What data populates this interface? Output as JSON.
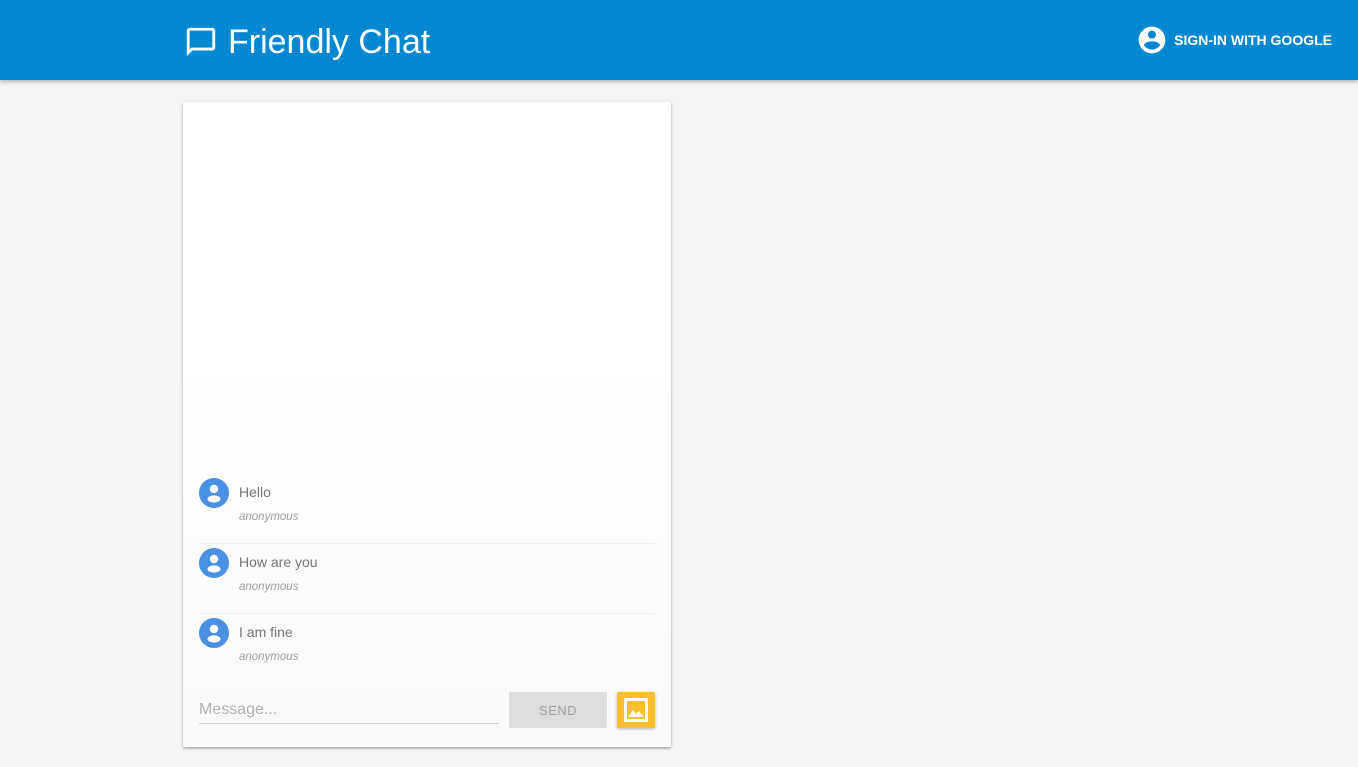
{
  "header": {
    "title": "Friendly Chat",
    "signin_label": "SIGN-IN WITH GOOGLE",
    "brand_icon": "chat-bubble-icon",
    "signin_icon": "account-circle-icon"
  },
  "messages": [
    {
      "text": "Hello",
      "name": "anonymous"
    },
    {
      "text": "How are you",
      "name": "anonymous"
    },
    {
      "text": "I am fine",
      "name": "anonymous"
    }
  ],
  "composer": {
    "placeholder": "Message...",
    "value": "",
    "send_label": "SEND",
    "image_icon": "image-icon"
  },
  "colors": {
    "header": "#0288d1",
    "avatar": "#4a90e2",
    "image_button": "#fbc02d",
    "background": "#f5f5f5"
  }
}
